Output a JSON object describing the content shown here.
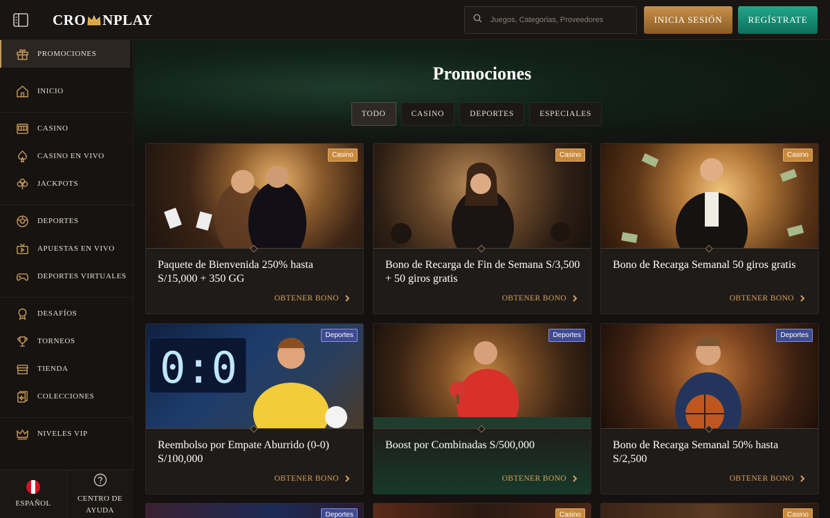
{
  "header": {
    "logo_pre": "CRO",
    "logo_post": "NPLAY",
    "search_placeholder": "Juegos, Categorias, Proveedores",
    "login_label": "INICIA SESIÓN",
    "register_label": "REGÍSTRATE"
  },
  "sidebar": {
    "items": [
      {
        "label": "PROMOCIONES",
        "icon": "gift-icon",
        "active": true
      },
      {
        "label": "INICIO",
        "icon": "home-icon"
      },
      {
        "label": "CASINO",
        "icon": "slot-machine-icon"
      },
      {
        "label": "CASINO EN VIVO",
        "icon": "spade-icon"
      },
      {
        "label": "JACKPOTS",
        "icon": "clover-icon"
      },
      {
        "label": "DEPORTES",
        "icon": "soccer-ball-icon"
      },
      {
        "label": "APUESTAS EN VIVO",
        "icon": "live-betting-icon"
      },
      {
        "label": "DEPORTES VIRTUALES",
        "icon": "gamepad-icon"
      },
      {
        "label": "DESAFÍOS",
        "icon": "medal-icon"
      },
      {
        "label": "TORNEOS",
        "icon": "trophy-icon"
      },
      {
        "label": "TIENDA",
        "icon": "store-icon"
      },
      {
        "label": "COLECCIONES",
        "icon": "cards-icon"
      },
      {
        "label": "NIVELES VIP",
        "icon": "crown-icon"
      }
    ],
    "footer": {
      "language_label": "ESPAÑOL",
      "help_label_1": "CENTRO DE",
      "help_label_2": "AYUDA"
    }
  },
  "main": {
    "title": "Promociones",
    "tabs": [
      {
        "label": "TODO",
        "active": true
      },
      {
        "label": "CASINO"
      },
      {
        "label": "DEPORTES"
      },
      {
        "label": "ESPECIALES"
      }
    ],
    "cta_label": "OBTENER BONO",
    "cards": [
      {
        "badge": "Casino",
        "title": "Paquete de Bienvenida 250% hasta S/15,000 + 350 GG"
      },
      {
        "badge": "Casino",
        "title": "Bono de Recarga de Fin de Semana S/3,500 + 50 giros gratis"
      },
      {
        "badge": "Casino",
        "title": "Bono de Recarga Semanal 50 giros gratis"
      },
      {
        "badge": "Deportes",
        "title": "Reembolso por Empate Aburrido (0-0) S/100,000"
      },
      {
        "badge": "Deportes",
        "title": "Boost por Combinadas S/500,000"
      },
      {
        "badge": "Deportes",
        "title": "Bono de Recarga Semanal 50% hasta S/2,500"
      }
    ],
    "partial_badges": [
      "Deportes",
      "Casino",
      "Casino"
    ]
  },
  "colors": {
    "accent_gold": "#c79a55",
    "register_green": "#16957a",
    "casino_badge": "#c98a3c",
    "deportes_badge": "#3f4a93"
  }
}
